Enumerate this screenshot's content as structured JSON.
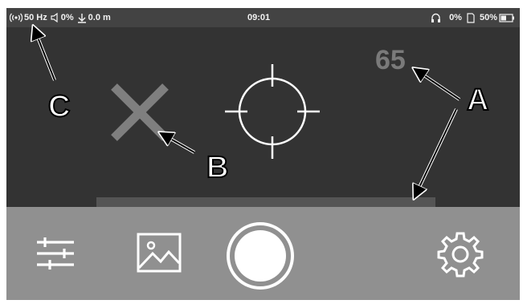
{
  "status_bar": {
    "wifi_frequency": "50 Hz",
    "volume": "0%",
    "distance": "0.0 m",
    "time": "09:01",
    "headphone_volume": "0%",
    "battery": "50%",
    "icons": {
      "wifi": "wifi-signal-icon",
      "speaker": "speaker-icon",
      "distance": "distance-down-arrow-icon",
      "headphone": "headphone-icon",
      "sd_card": "sd-card-icon",
      "battery": "battery-icon"
    }
  },
  "viewfinder": {
    "range_value": "65",
    "x_marker_icon": "x-marker-icon",
    "reticle_icon": "crosshair-reticle-icon",
    "distance_bar_level": 1.0
  },
  "toolbar": {
    "adjust_icon": "sliders-icon",
    "gallery_icon": "image-gallery-icon",
    "record_icon": "record-button-icon",
    "settings_icon": "gear-icon"
  },
  "callouts": {
    "a": "A",
    "b": "B",
    "c": "C"
  },
  "colors": {
    "screen_bg": "#333333",
    "status_bg": "#434343",
    "toolbar_bg": "#909090",
    "range_text": "#7a7a7a",
    "x_marker": "#7f7f7f"
  }
}
